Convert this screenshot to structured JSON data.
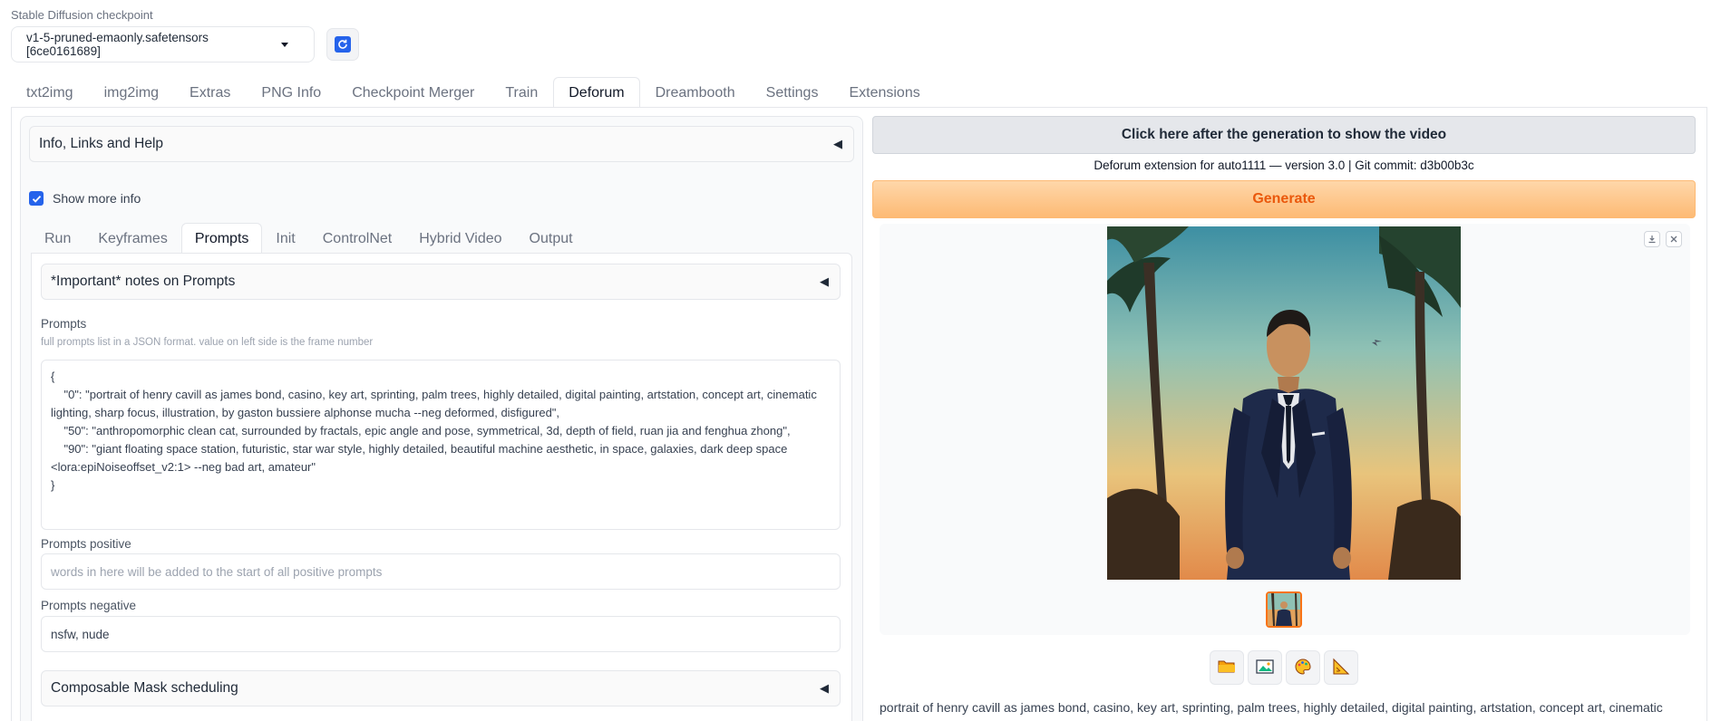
{
  "checkpoint": {
    "label": "Stable Diffusion checkpoint",
    "value": "v1-5-pruned-emaonly.safetensors [6ce0161689]"
  },
  "main_tabs": [
    "txt2img",
    "img2img",
    "Extras",
    "PNG Info",
    "Checkpoint Merger",
    "Train",
    "Deforum",
    "Dreambooth",
    "Settings",
    "Extensions"
  ],
  "active_main_tab": "Deforum",
  "info_accordion": {
    "label": "Info, Links and Help",
    "arrow": "◀"
  },
  "show_more_info": {
    "label": "Show more info",
    "checked": true
  },
  "sub_tabs": [
    "Run",
    "Keyframes",
    "Prompts",
    "Init",
    "ControlNet",
    "Hybrid Video",
    "Output"
  ],
  "active_sub_tab": "Prompts",
  "notes_accordion": {
    "label": "*Important* notes on Prompts",
    "arrow": "◀"
  },
  "prompts": {
    "label": "Prompts",
    "info": "full prompts list in a JSON format.  value on left side is the frame number",
    "value": "{\n    \"0\": \"portrait of henry cavill as james bond, casino, key art, sprinting, palm trees, highly detailed, digital painting, artstation, concept art, cinematic lighting, sharp focus, illustration, by gaston bussiere alphonse mucha --neg deformed, disfigured\",\n    \"50\": \"anthropomorphic clean cat, surrounded by fractals, epic angle and pose, symmetrical, 3d, depth of field, ruan jia and fenghua zhong\",\n    \"90\": \"giant floating space station, futuristic, star war style, highly detailed, beautiful machine aesthetic, in space, galaxies, dark deep space <lora:epiNoiseoffset_v2:1> --neg bad art, amateur\"\n}"
  },
  "prompts_positive": {
    "label": "Prompts positive",
    "placeholder": "words in here will be added to the start of all positive prompts"
  },
  "prompts_negative": {
    "label": "Prompts negative",
    "value": "nsfw, nude"
  },
  "mask_accordion": {
    "label": "Composable Mask scheduling",
    "arrow": "◀"
  },
  "video_button": "Click here after the generation to show the video",
  "version_text": "Deforum extension for auto1111 — version 3.0 | Git commit: d3b00b3c",
  "generate_button": "Generate",
  "output_text": "portrait of henry cavill as james bond, casino, key art, sprinting, palm trees, highly detailed, digital painting, artstation, concept art, cinematic lighting,",
  "colors": {
    "accent": "#2563eb",
    "generate_text": "#ea580c",
    "generate_bg": "#fdba74"
  },
  "icons": {
    "refresh": "refresh-icon",
    "tools": [
      "folder-icon",
      "image-icon",
      "palette-icon",
      "ruler-icon"
    ],
    "gallery": [
      "download-icon",
      "close-icon"
    ]
  }
}
